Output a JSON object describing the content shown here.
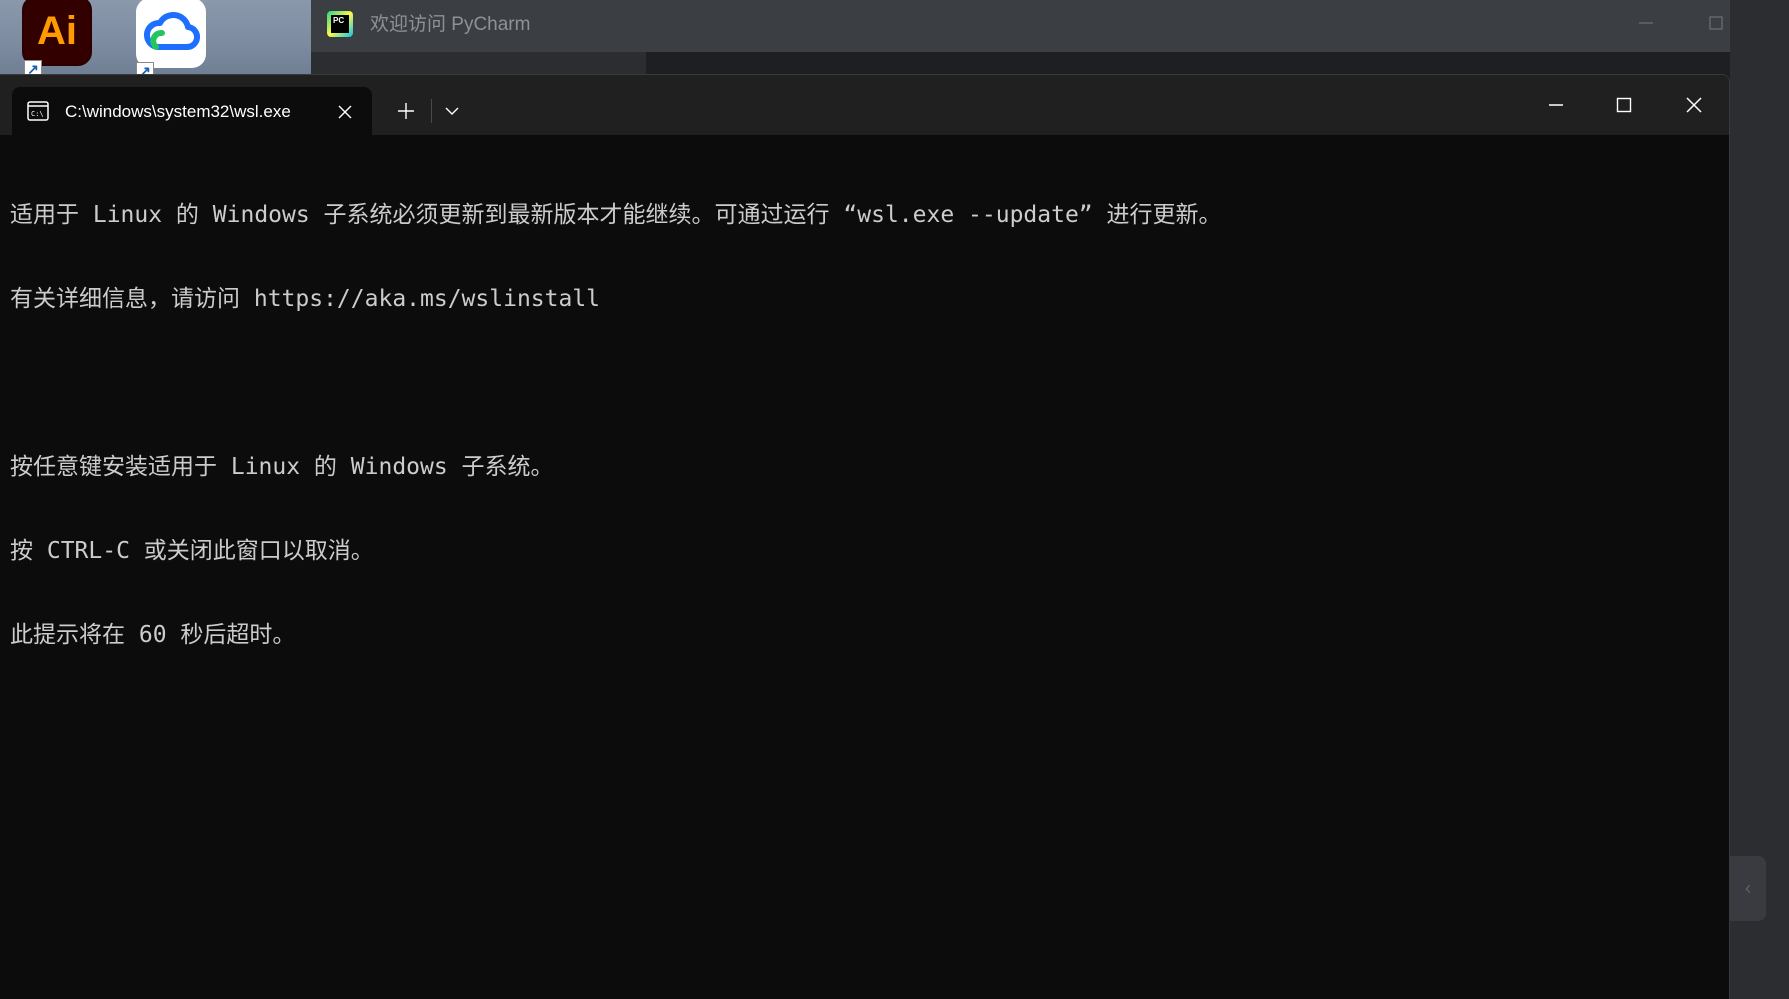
{
  "desktop": {
    "icons": [
      {
        "name": "Adobe Illustrator",
        "label": "Ai"
      },
      {
        "name": "cloud sync app",
        "label": ""
      }
    ]
  },
  "pycharm": {
    "title": "欢迎访问 PyCharm",
    "logo_text": "PC"
  },
  "terminal": {
    "tab_title": "C:\\windows\\system32\\wsl.exe",
    "new_tab_symbol": "+",
    "lines": [
      "适用于 Linux 的 Windows 子系统必须更新到最新版本才能继续。可通过运行 “wsl.exe --update” 进行更新。",
      "有关详细信息，请访问 https://aka.ms/wslinstall",
      "",
      "按任意键安装适用于 Linux 的 Windows 子系统。",
      "按 CTRL-C 或关闭此窗口以取消。",
      "此提示将在 60 秒后超时。"
    ]
  },
  "colors": {
    "terminal_bg": "#0c0c0c",
    "titlebar_bg": "#202020",
    "text": "#cccccc",
    "pycharm_bg": "#2b2d30"
  }
}
